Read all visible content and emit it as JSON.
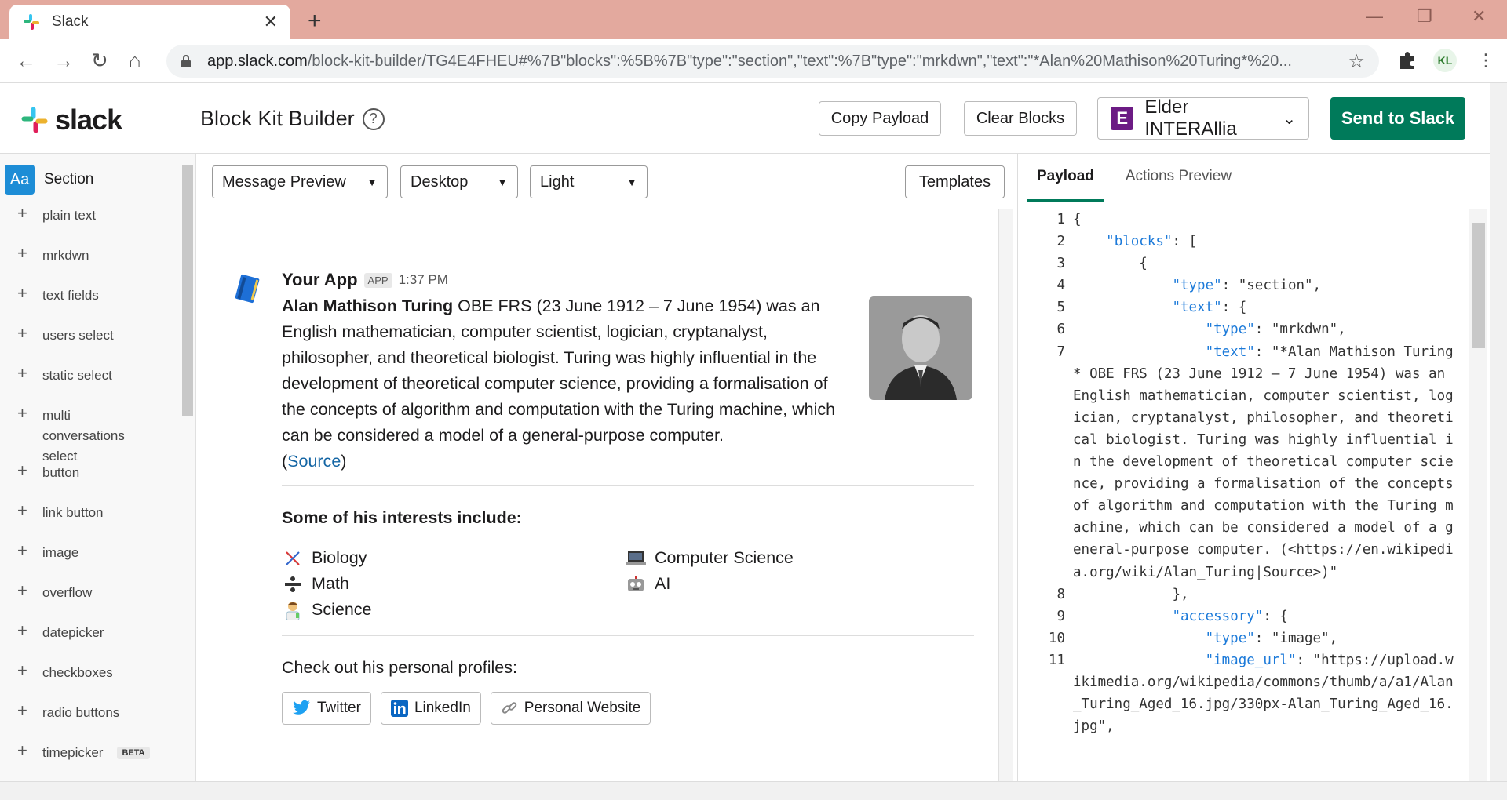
{
  "browser": {
    "tab_title": "Slack",
    "url_host": "app.slack.com",
    "url_path": "/block-kit-builder/TG4E4FHEU#%7B\"blocks\":%5B%7B\"type\":\"section\",\"text\":%7B\"type\":\"mrkdwn\",\"text\":\"*Alan%20Mathison%20Turing*%20...",
    "profile_initials": "KL"
  },
  "header": {
    "logo_word": "slack",
    "title": "Block Kit Builder",
    "help": "?",
    "copy_payload": "Copy Payload",
    "clear_blocks": "Clear Blocks",
    "workspace_letter": "E",
    "workspace": "Elder INTERAllia",
    "send": "Send to Slack"
  },
  "sidebar": {
    "section_icon": "Aa",
    "section_label": "Section",
    "items": [
      "plain text",
      "mrkdwn",
      "text fields",
      "users select",
      "static select",
      "multi conversations select",
      "button",
      "link button",
      "image",
      "overflow",
      "datepicker",
      "checkboxes",
      "radio buttons",
      "timepicker"
    ],
    "beta": "BETA"
  },
  "toolbar": {
    "preview": "Message Preview",
    "device": "Desktop",
    "theme": "Light",
    "templates": "Templates"
  },
  "message": {
    "app_name": "Your App",
    "app_badge": "APP",
    "time": "1:37 PM",
    "bold_name": "Alan Mathison Turing",
    "body": " OBE FRS (23 June 1912 – 7 June 1954) was an English mathematician, computer scientist, logician, cryptanalyst, philosopher, and theoretical biologist. Turing was highly influential in the development of theoretical computer science, providing a formalisation of the concepts of algorithm and computation with the Turing machine, which can be considered a model of a general-purpose computer.",
    "source_open": "(",
    "source": "Source",
    "source_close": ")",
    "interests_title": "Some of his interests include:",
    "interests": [
      "Biology",
      "Computer Science",
      "Math",
      "AI",
      "Science"
    ],
    "profiles_title": "Check out his personal profiles:",
    "buttons": [
      "Twitter",
      "LinkedIn",
      "Personal Website"
    ]
  },
  "payload": {
    "tabs": [
      "Payload",
      "Actions Preview"
    ],
    "lines": [
      {
        "n": "1",
        "c": "{"
      },
      {
        "n": "2",
        "c": "    \"blocks\": ["
      },
      {
        "n": "3",
        "c": "        {"
      },
      {
        "n": "4",
        "c": "            \"type\": \"section\","
      },
      {
        "n": "5",
        "c": "            \"text\": {"
      },
      {
        "n": "6",
        "c": "                \"type\": \"mrkdwn\","
      },
      {
        "n": "7",
        "c": "                \"text\": \"*Alan Mathison Turing* OBE FRS (23 June 1912 – 7 June 1954) was an English mathematician, computer scientist, logician, cryptanalyst, philosopher, and theoretical biologist. Turing was highly influential in the development of theoretical computer science, providing a formalisation of the concepts of algorithm and computation with the Turing machine, which can be considered a model of a general-purpose computer. (<https://en.wikipedia.org/wiki/Alan_Turing|Source>)\""
      },
      {
        "n": "8",
        "c": "            },"
      },
      {
        "n": "9",
        "c": "            \"accessory\": {"
      },
      {
        "n": "10",
        "c": "                \"type\": \"image\","
      },
      {
        "n": "11",
        "c": "                \"image_url\": \"https://upload.wikimedia.org/wikipedia/commons/thumb/a/a1/Alan_Turing_Aged_16.jpg/330px-Alan_Turing_Aged_16.jpg\","
      }
    ]
  }
}
